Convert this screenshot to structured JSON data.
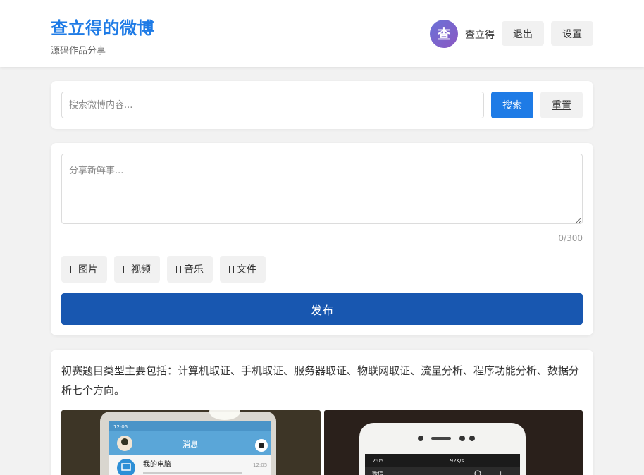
{
  "header": {
    "title": "查立得的微博",
    "subtitle": "源码作品分享",
    "avatar_initial": "查",
    "username": "查立得",
    "logout_label": "退出",
    "settings_label": "设置"
  },
  "search": {
    "placeholder": "搜索微博内容...",
    "search_label": "搜索",
    "reset_label": "重置"
  },
  "compose": {
    "placeholder": "分享新鲜事...",
    "counter": "0/300",
    "media_buttons": [
      {
        "label": "图片",
        "icon": "image-icon"
      },
      {
        "label": "视频",
        "icon": "video-icon"
      },
      {
        "label": "音乐",
        "icon": "music-icon"
      },
      {
        "label": "文件",
        "icon": "file-icon"
      }
    ],
    "publish_label": "发布"
  },
  "post": {
    "text": "初赛题目类型主要包括：计算机取证、手机取证、服务器取证、物联网取证、流量分析、程序功能分析、数据分析七个方向。",
    "images": [
      {
        "screen_title": "消息",
        "row_label": "我的电脑",
        "time": "12:05"
      },
      {
        "status_left": "12:05",
        "status_right": "1.92K/s",
        "app_label": "微信"
      }
    ]
  },
  "colors": {
    "brand": "#1e7be6",
    "publish": "#1857b0",
    "avatar": "#7463cf",
    "background": "#f2f2f2"
  }
}
